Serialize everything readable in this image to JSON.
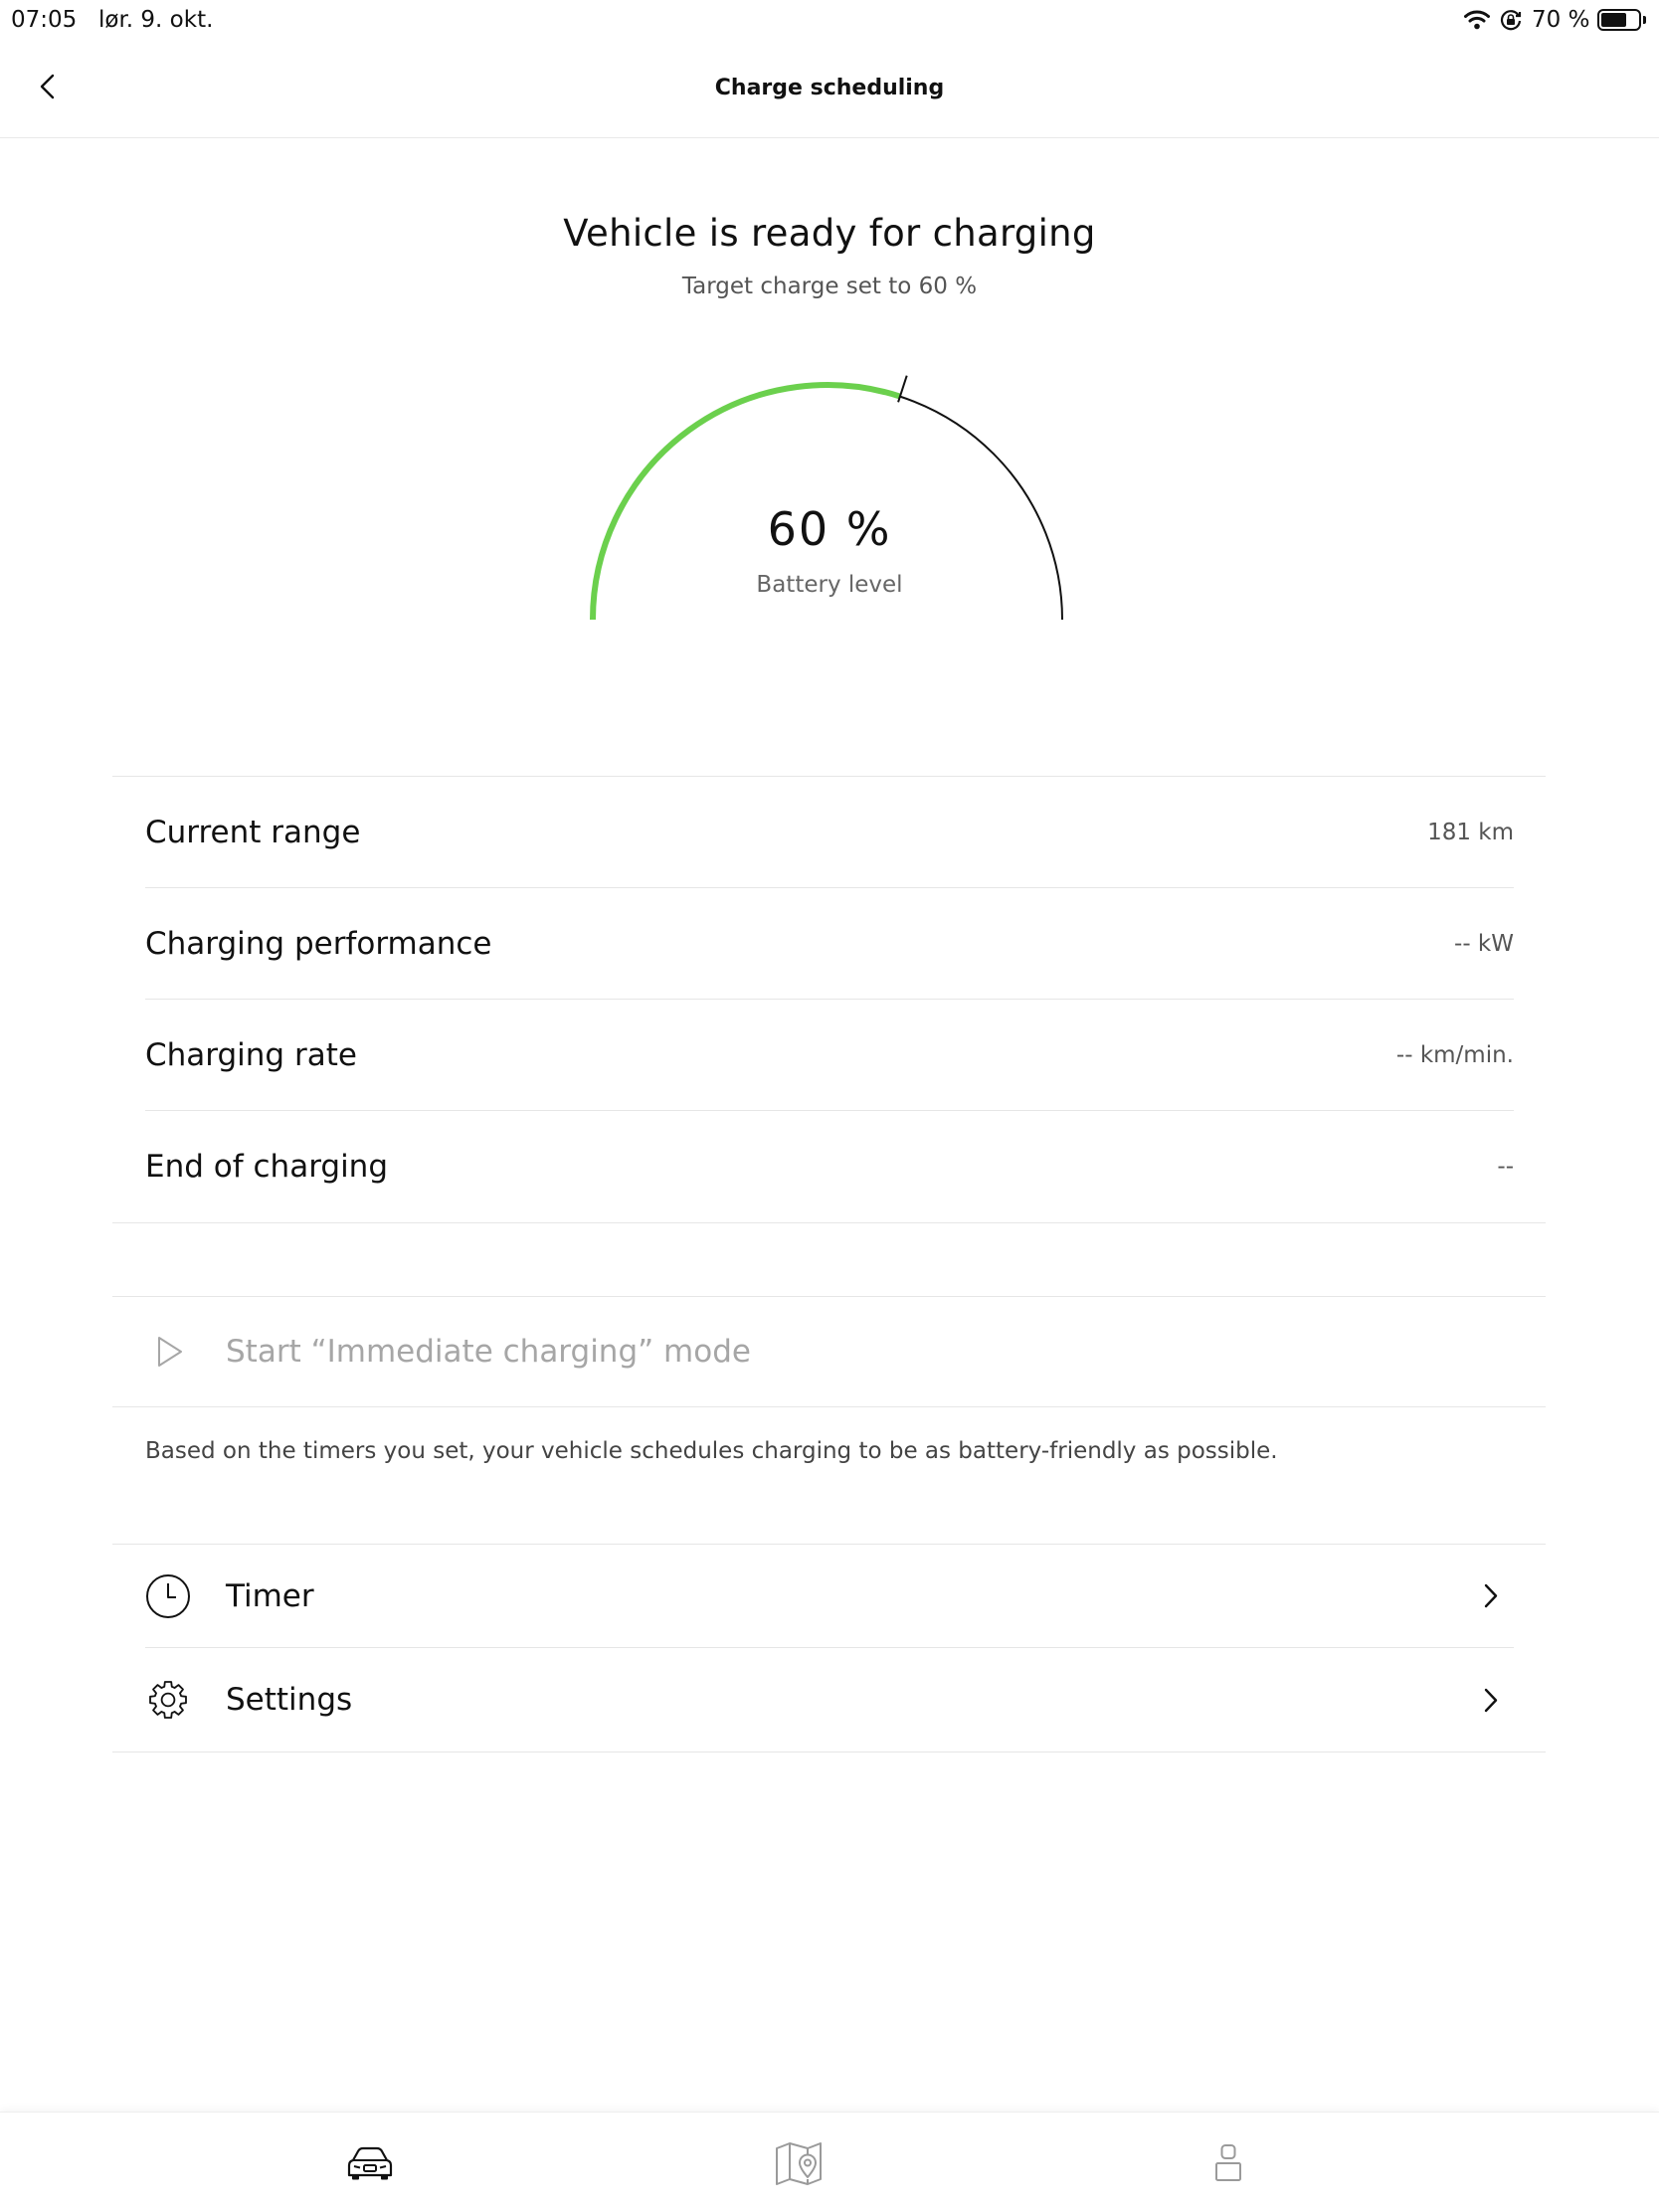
{
  "status_bar": {
    "time": "07:05",
    "date": "lør. 9. okt.",
    "battery_text": "70 %",
    "battery_level": 0.7,
    "icons": [
      "wifi-icon",
      "orientation-lock-icon",
      "battery-icon"
    ]
  },
  "header": {
    "title": "Charge scheduling",
    "back_icon": "chevron-left-icon"
  },
  "status": {
    "title": "Vehicle is ready for charging",
    "subtitle": "Target charge set to 60 %"
  },
  "gauge": {
    "battery_level_pct": 60,
    "target_pct": 60,
    "value_text": "60 %",
    "label": "Battery level",
    "fill_color": "#6bd04d",
    "track_color": "#111111"
  },
  "details": [
    {
      "label": "Current range",
      "value": "181 km"
    },
    {
      "label": "Charging performance",
      "value": "-- kW"
    },
    {
      "label": "Charging rate",
      "value": "-- km/min."
    },
    {
      "label": "End of charging",
      "value": "--"
    }
  ],
  "immediate_charging": {
    "label": "Start “Immediate charging” mode",
    "icon": "play-icon",
    "color": "#a6a6a6"
  },
  "description": "Based on the timers you set, your vehicle schedules charging to be as battery-friendly as possible.",
  "menu": [
    {
      "label": "Timer",
      "icon": "clock-icon"
    },
    {
      "label": "Settings",
      "icon": "gear-icon"
    }
  ],
  "tab_bar": {
    "tabs": [
      {
        "icon": "car-icon",
        "active": true
      },
      {
        "icon": "map-icon",
        "active": false
      },
      {
        "icon": "profile-icon",
        "active": false
      }
    ],
    "active_color": "#111111",
    "inactive_color": "#9a9a9a"
  }
}
